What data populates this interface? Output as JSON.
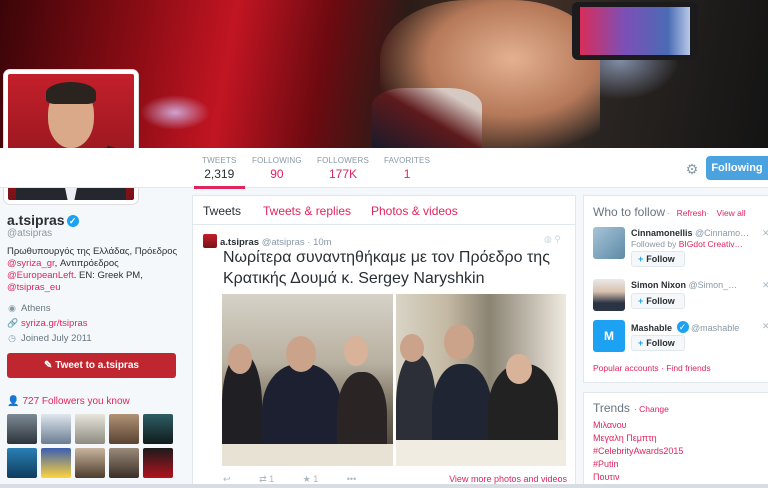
{
  "profile": {
    "name": "a.tsipras",
    "handle": "@atsipras",
    "bio_line1": "Πρωθυπουργός της Ελλάδας, Πρόεδρος",
    "bio_link1": "@syriza_gr",
    "bio_line2": ", Αντιπρόεδρος",
    "bio_link2": "@EuropeanLeft",
    "bio_line3": ". EN: Greek PM,",
    "bio_link3": "@tsipras_eu",
    "location": "Athens",
    "website": "syriza.gr/tsipras",
    "joined": "Joined July 2011",
    "tweet_to_label": "Tweet to a.tsipras",
    "followers_you_know": "727 Followers you know"
  },
  "stats": [
    {
      "label": "TWEETS",
      "value": "2,319"
    },
    {
      "label": "FOLLOWING",
      "value": "90"
    },
    {
      "label": "FOLLOWERS",
      "value": "177K"
    },
    {
      "label": "FAVORITES",
      "value": "1"
    }
  ],
  "following_button": "Following",
  "tabs": [
    "Tweets",
    "Tweets & replies",
    "Photos & videos"
  ],
  "tweet": {
    "author": "a.tsipras",
    "handle": "@atsipras",
    "time": "· 10m",
    "text": "Νωρίτερα συναντηθήκαμε με τον Πρόεδρο της Κρατικής Δουμά κ. Sergey Naryshkin",
    "reply_count": "",
    "retweet_count": "1",
    "favorite_count": "1",
    "more": "View more photos and videos"
  },
  "who_to_follow": {
    "title": "Who to follow",
    "refresh": "Refresh",
    "sep": "·",
    "view_all": "View all",
    "follow_label": "Follow",
    "suggestions": [
      {
        "name": "Cinnamonellis",
        "handle": "@Cinnamo…",
        "sub_prefix": "Followed by ",
        "sub_link": "BIGdot Creativ…"
      },
      {
        "name": "Simon Nixon",
        "handle": "@Simon_…",
        "sub_prefix": "",
        "sub_link": ""
      },
      {
        "name": "Mashable",
        "handle": "@mashable",
        "sub_prefix": "",
        "sub_link": ""
      }
    ],
    "footer": "Popular accounts · Find friends"
  },
  "trends": {
    "title": "Trends",
    "change": "· Change",
    "items": [
      "Μιλανου",
      "Μεγαλη Πεμπτη",
      "#CelebrityAwards2015",
      "#Putin",
      "Πουτιν"
    ]
  },
  "colors": {
    "accent": "#e0245e",
    "button_blue": "#4aa3df",
    "tweet_to_red": "#c0262f"
  }
}
